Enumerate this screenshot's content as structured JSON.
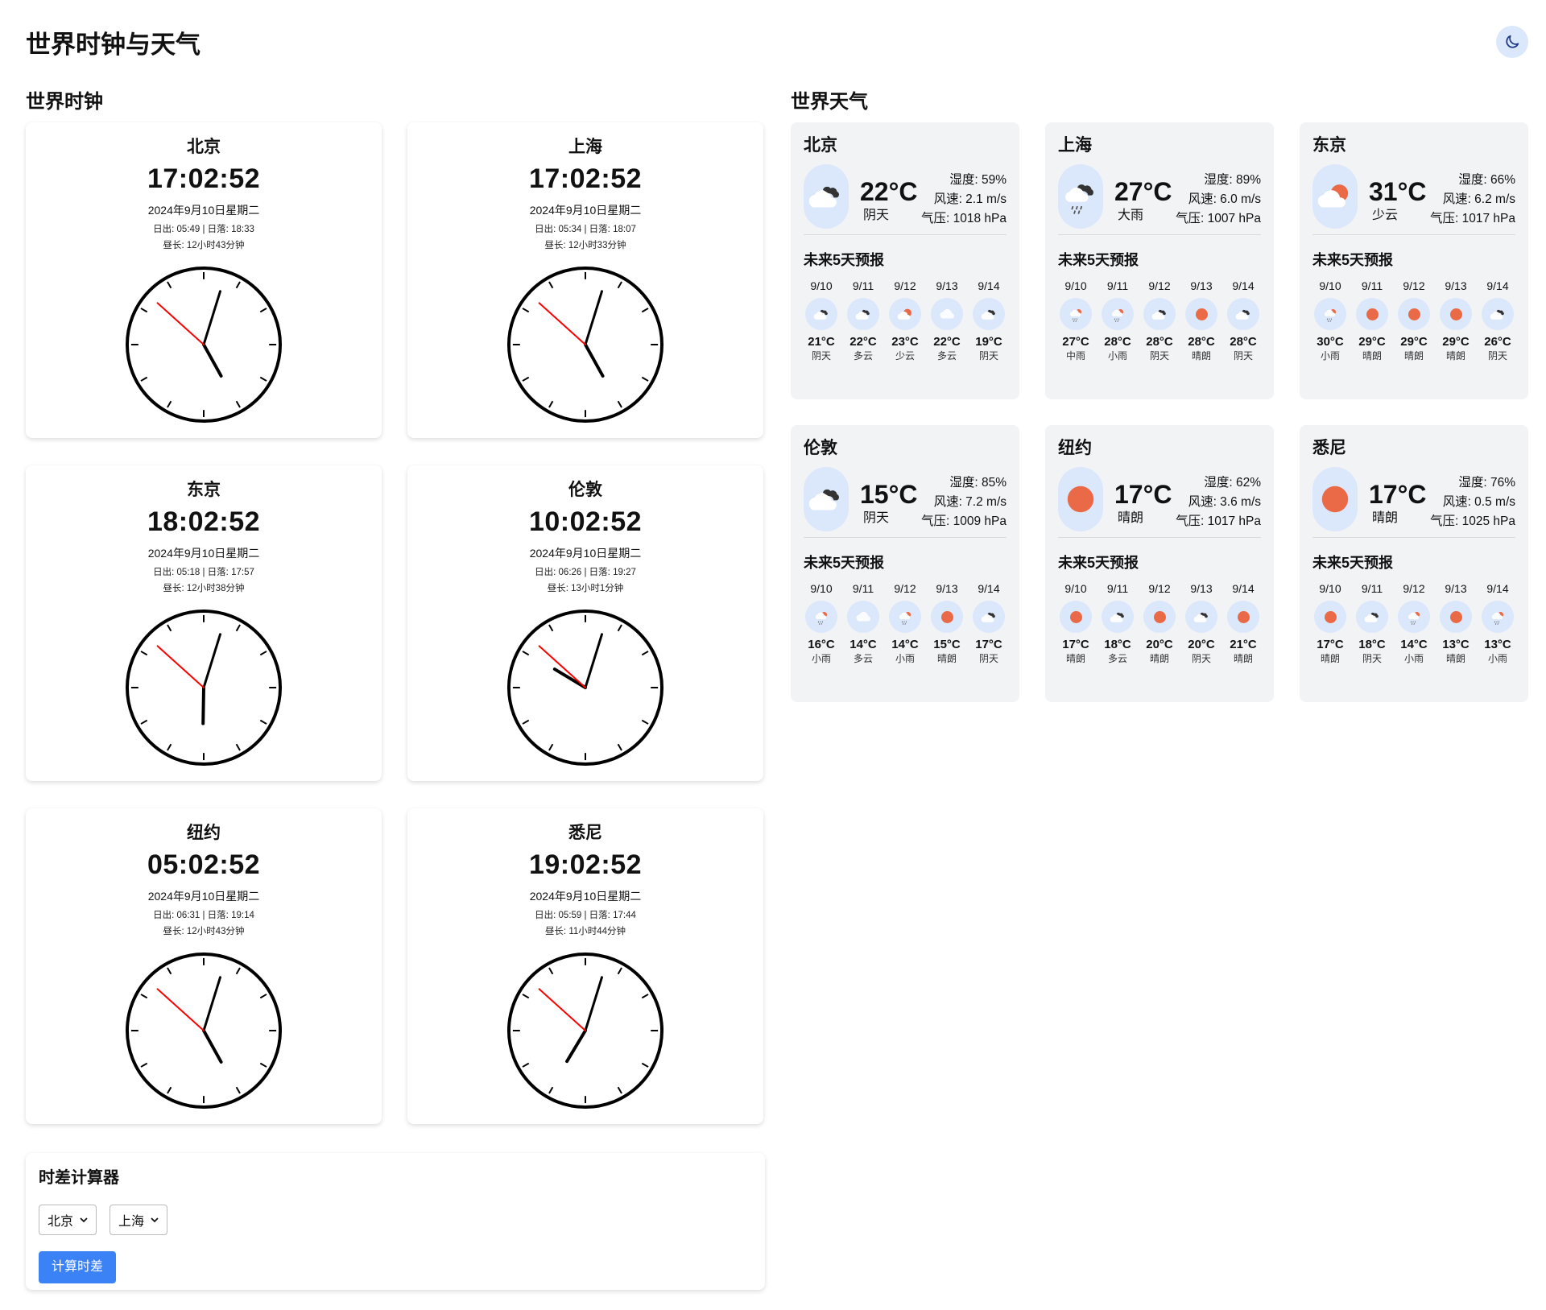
{
  "header": {
    "title": "世界时钟与天气",
    "theme_icon": "moon-icon"
  },
  "sections": {
    "clock_title": "世界时钟",
    "weather_title": "世界天气"
  },
  "clocks": [
    {
      "city": "北京",
      "time": "17:02:52",
      "date": "2024年9月10日星期二",
      "sun": "日出: 05:49 | 日落: 18:33",
      "daylength": "昼长: 12小时43分钟",
      "h": 17,
      "m": 2,
      "s": 52
    },
    {
      "city": "上海",
      "time": "17:02:52",
      "date": "2024年9月10日星期二",
      "sun": "日出: 05:34 | 日落: 18:07",
      "daylength": "昼长: 12小时33分钟",
      "h": 17,
      "m": 2,
      "s": 52
    },
    {
      "city": "东京",
      "time": "18:02:52",
      "date": "2024年9月10日星期二",
      "sun": "日出: 05:18 | 日落: 17:57",
      "daylength": "昼长: 12小时38分钟",
      "h": 18,
      "m": 2,
      "s": 52
    },
    {
      "city": "伦敦",
      "time": "10:02:52",
      "date": "2024年9月10日星期二",
      "sun": "日出: 06:26 | 日落: 19:27",
      "daylength": "昼长: 13小时1分钟",
      "h": 10,
      "m": 2,
      "s": 52
    },
    {
      "city": "纽约",
      "time": "05:02:52",
      "date": "2024年9月10日星期二",
      "sun": "日出: 06:31 | 日落: 19:14",
      "daylength": "昼长: 12小时43分钟",
      "h": 5,
      "m": 2,
      "s": 52
    },
    {
      "city": "悉尼",
      "time": "19:02:52",
      "date": "2024年9月10日星期二",
      "sun": "日出: 05:59 | 日落: 17:44",
      "daylength": "昼长: 11小时44分钟",
      "h": 19,
      "m": 2,
      "s": 52
    }
  ],
  "time_diff": {
    "title": "时差计算器",
    "from": "北京",
    "to": "上海",
    "button": "计算时差"
  },
  "weather": [
    {
      "city": "北京",
      "temp": "22°C",
      "cond": "阴天",
      "icon": "overcast",
      "humidity": "湿度: 59%",
      "wind": "风速: 2.1 m/s",
      "pressure": "气压: 1018 hPa",
      "forecast_title": "未来5天预报",
      "forecast": [
        {
          "date": "9/10",
          "temp": "21°C",
          "cond": "阴天",
          "icon": "overcast"
        },
        {
          "date": "9/11",
          "temp": "22°C",
          "cond": "多云",
          "icon": "overcast"
        },
        {
          "date": "9/12",
          "temp": "23°C",
          "cond": "少云",
          "icon": "few-clouds"
        },
        {
          "date": "9/13",
          "temp": "22°C",
          "cond": "多云",
          "icon": "cloud"
        },
        {
          "date": "9/14",
          "temp": "19°C",
          "cond": "阴天",
          "icon": "overcast"
        }
      ]
    },
    {
      "city": "上海",
      "temp": "27°C",
      "cond": "大雨",
      "icon": "rain",
      "humidity": "湿度: 89%",
      "wind": "风速: 6.0 m/s",
      "pressure": "气压: 1007 hPa",
      "forecast_title": "未来5天预报",
      "forecast": [
        {
          "date": "9/10",
          "temp": "27°C",
          "cond": "中雨",
          "icon": "light-rain"
        },
        {
          "date": "9/11",
          "temp": "28°C",
          "cond": "小雨",
          "icon": "light-rain"
        },
        {
          "date": "9/12",
          "temp": "28°C",
          "cond": "阴天",
          "icon": "overcast"
        },
        {
          "date": "9/13",
          "temp": "28°C",
          "cond": "晴朗",
          "icon": "sun"
        },
        {
          "date": "9/14",
          "temp": "28°C",
          "cond": "阴天",
          "icon": "overcast"
        }
      ]
    },
    {
      "city": "东京",
      "temp": "31°C",
      "cond": "少云",
      "icon": "few-clouds",
      "humidity": "湿度: 66%",
      "wind": "风速: 6.2 m/s",
      "pressure": "气压: 1017 hPa",
      "forecast_title": "未来5天预报",
      "forecast": [
        {
          "date": "9/10",
          "temp": "30°C",
          "cond": "小雨",
          "icon": "light-rain"
        },
        {
          "date": "9/11",
          "temp": "29°C",
          "cond": "晴朗",
          "icon": "sun"
        },
        {
          "date": "9/12",
          "temp": "29°C",
          "cond": "晴朗",
          "icon": "sun"
        },
        {
          "date": "9/13",
          "temp": "29°C",
          "cond": "晴朗",
          "icon": "sun"
        },
        {
          "date": "9/14",
          "temp": "26°C",
          "cond": "阴天",
          "icon": "overcast"
        }
      ]
    },
    {
      "city": "伦敦",
      "temp": "15°C",
      "cond": "阴天",
      "icon": "overcast",
      "humidity": "湿度: 85%",
      "wind": "风速: 7.2 m/s",
      "pressure": "气压: 1009 hPa",
      "forecast_title": "未来5天预报",
      "forecast": [
        {
          "date": "9/10",
          "temp": "16°C",
          "cond": "小雨",
          "icon": "light-rain"
        },
        {
          "date": "9/11",
          "temp": "14°C",
          "cond": "多云",
          "icon": "cloud"
        },
        {
          "date": "9/12",
          "temp": "14°C",
          "cond": "小雨",
          "icon": "light-rain"
        },
        {
          "date": "9/13",
          "temp": "15°C",
          "cond": "晴朗",
          "icon": "sun"
        },
        {
          "date": "9/14",
          "temp": "17°C",
          "cond": "阴天",
          "icon": "overcast"
        }
      ]
    },
    {
      "city": "纽约",
      "temp": "17°C",
      "cond": "晴朗",
      "icon": "sun",
      "humidity": "湿度: 62%",
      "wind": "风速: 3.6 m/s",
      "pressure": "气压: 1017 hPa",
      "forecast_title": "未来5天预报",
      "forecast": [
        {
          "date": "9/10",
          "temp": "17°C",
          "cond": "晴朗",
          "icon": "sun"
        },
        {
          "date": "9/11",
          "temp": "18°C",
          "cond": "多云",
          "icon": "overcast"
        },
        {
          "date": "9/12",
          "temp": "20°C",
          "cond": "晴朗",
          "icon": "sun"
        },
        {
          "date": "9/13",
          "temp": "20°C",
          "cond": "阴天",
          "icon": "overcast"
        },
        {
          "date": "9/14",
          "temp": "21°C",
          "cond": "晴朗",
          "icon": "sun"
        }
      ]
    },
    {
      "city": "悉尼",
      "temp": "17°C",
      "cond": "晴朗",
      "icon": "sun",
      "humidity": "湿度: 76%",
      "wind": "风速: 0.5 m/s",
      "pressure": "气压: 1025 hPa",
      "forecast_title": "未来5天预报",
      "forecast": [
        {
          "date": "9/10",
          "temp": "17°C",
          "cond": "晴朗",
          "icon": "sun"
        },
        {
          "date": "9/11",
          "temp": "18°C",
          "cond": "阴天",
          "icon": "overcast"
        },
        {
          "date": "9/12",
          "temp": "14°C",
          "cond": "小雨",
          "icon": "light-rain"
        },
        {
          "date": "9/13",
          "temp": "13°C",
          "cond": "晴朗",
          "icon": "sun"
        },
        {
          "date": "9/14",
          "temp": "13°C",
          "cond": "小雨",
          "icon": "light-rain"
        }
      ]
    }
  ],
  "colors": {
    "accent": "#3b82f6",
    "bubble": "#dbe7fb",
    "sun": "#ea6a47",
    "second_hand": "#ff0000",
    "card_bg": "#f2f3f5"
  }
}
